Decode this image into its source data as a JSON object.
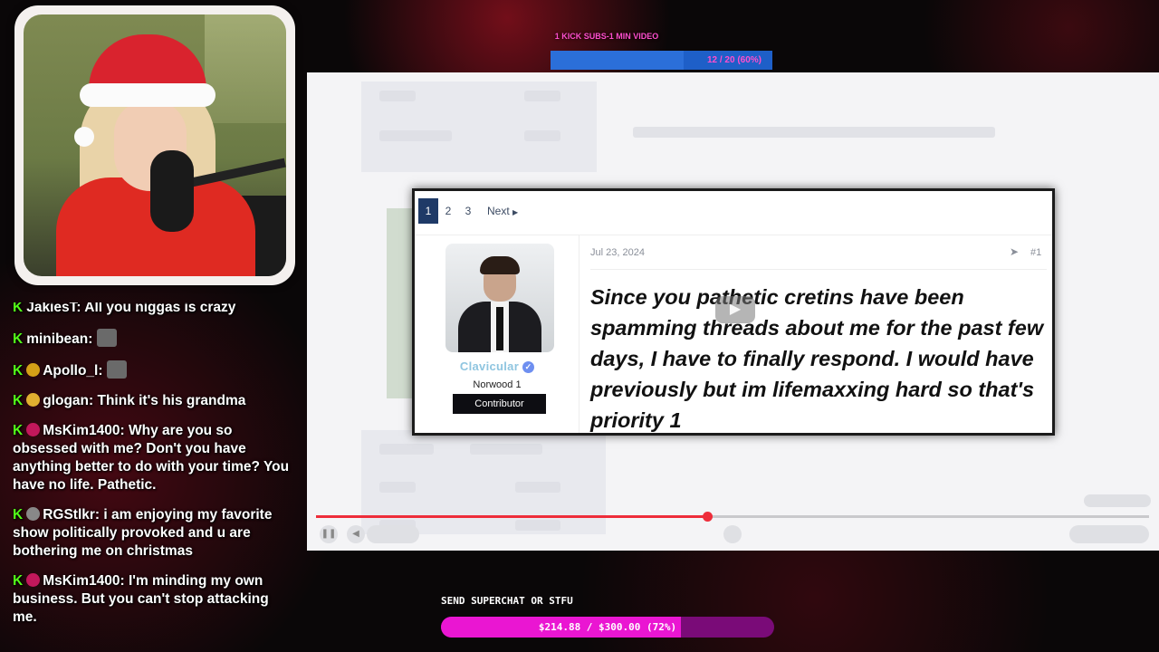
{
  "top_goal": {
    "label": "1 KICK SUBS-1 MIN VIDEO",
    "progress_text": "12 / 20 (60%)",
    "progress": 0.6
  },
  "chat": {
    "messages": [
      {
        "user": "JakiesT",
        "text": "All you niggas is crazy",
        "badge_color": ""
      },
      {
        "user": "minibean",
        "text": "",
        "badge_color": "",
        "emote": true
      },
      {
        "user": "Apollo_l",
        "text": "",
        "badge_color": "#d4a017",
        "emote": true
      },
      {
        "user": "glogan",
        "text": "Think it's his grandma",
        "badge_color": "#e0b030"
      },
      {
        "user": "MsKim1400",
        "text": "Why are you so obsessed with me? Don't you have anything better to do with your time? You have no life. Pathetic.",
        "badge_color": "#c2185b"
      },
      {
        "user": "RGStlkr",
        "text": "i am enjoying my favorite show politically provoked and u are bothering me on christmas",
        "badge_color": "#888888"
      },
      {
        "user": "MsKim1400",
        "text": "I'm minding my own business. But you can't stop attacking me.",
        "badge_color": "#c2185b"
      }
    ]
  },
  "forum": {
    "pages": [
      "1",
      "2",
      "3"
    ],
    "next_label": "Next",
    "username": "Clavicular",
    "user_title": "Norwood 1",
    "user_banner": "Contributor",
    "date": "Jul 23, 2024",
    "post_number": "#1",
    "body": "Since you pathetic cretins have been spamming threads about me for the past few days, I have to finally respond. I would have previously but im lifemaxxing hard so that's priority 1"
  },
  "video": {
    "progress": 0.47
  },
  "superchat_goal": {
    "label": "SEND SUPERCHAT OR STFU",
    "progress_text": "$214.88 / $300.00 (72%)",
    "progress": 0.72
  },
  "colors": {
    "kick_green": "#53fc18",
    "superchat_pink": "#ea16d2",
    "goal_blue": "#2b6fd9",
    "forum_page_active": "#1f3a67"
  }
}
